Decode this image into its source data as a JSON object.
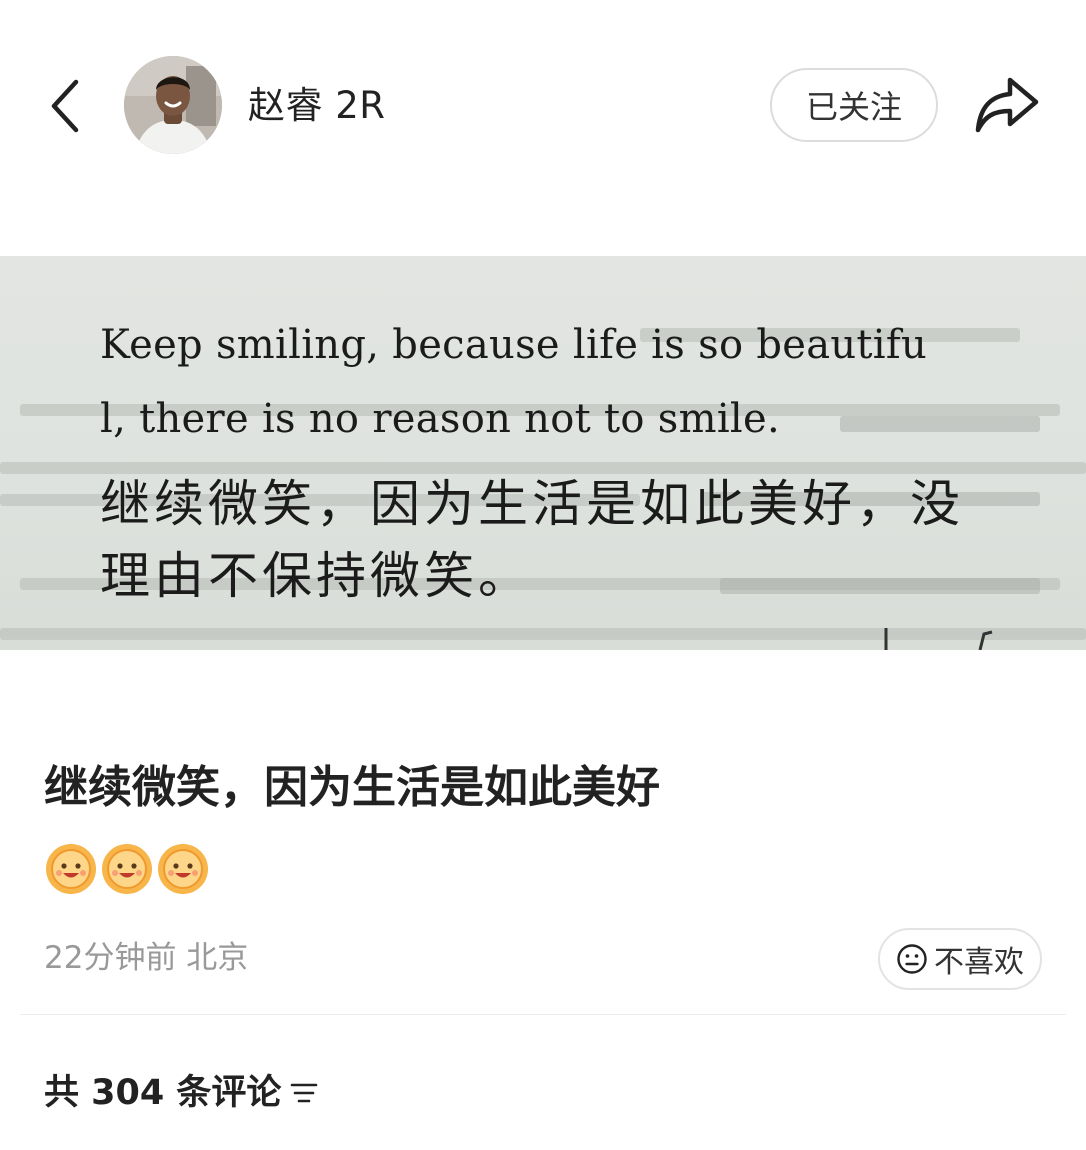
{
  "header": {
    "back_icon": "chevron-left-icon",
    "author_name": "赵睿 2R",
    "follow_label": "已关注",
    "share_icon": "share-arrow-icon"
  },
  "photo": {
    "english_line1": "Keep smiling, because life is so beautifu",
    "english_line2": "l, there is no reason not to smile.",
    "chinese_line1": "继续微笑，因为生活是如此美好，没",
    "chinese_line2": "理由不保持微笑。"
  },
  "post": {
    "title": "继续微笑，因为生活是如此美好",
    "emojis": [
      "sun-smile-emoji",
      "sun-smile-emoji",
      "sun-smile-emoji"
    ],
    "meta": "22分钟前 北京",
    "dislike_label": "不喜欢",
    "dislike_icon": "meh-face-icon"
  },
  "comments": {
    "count_label": "共 304 条评论",
    "sort_icon": "sort-lines-icon"
  },
  "colors": {
    "text_primary": "#222222",
    "text_secondary": "#999999",
    "button_border": "#dcdcdc",
    "emoji_orange": "#f6a53c"
  }
}
